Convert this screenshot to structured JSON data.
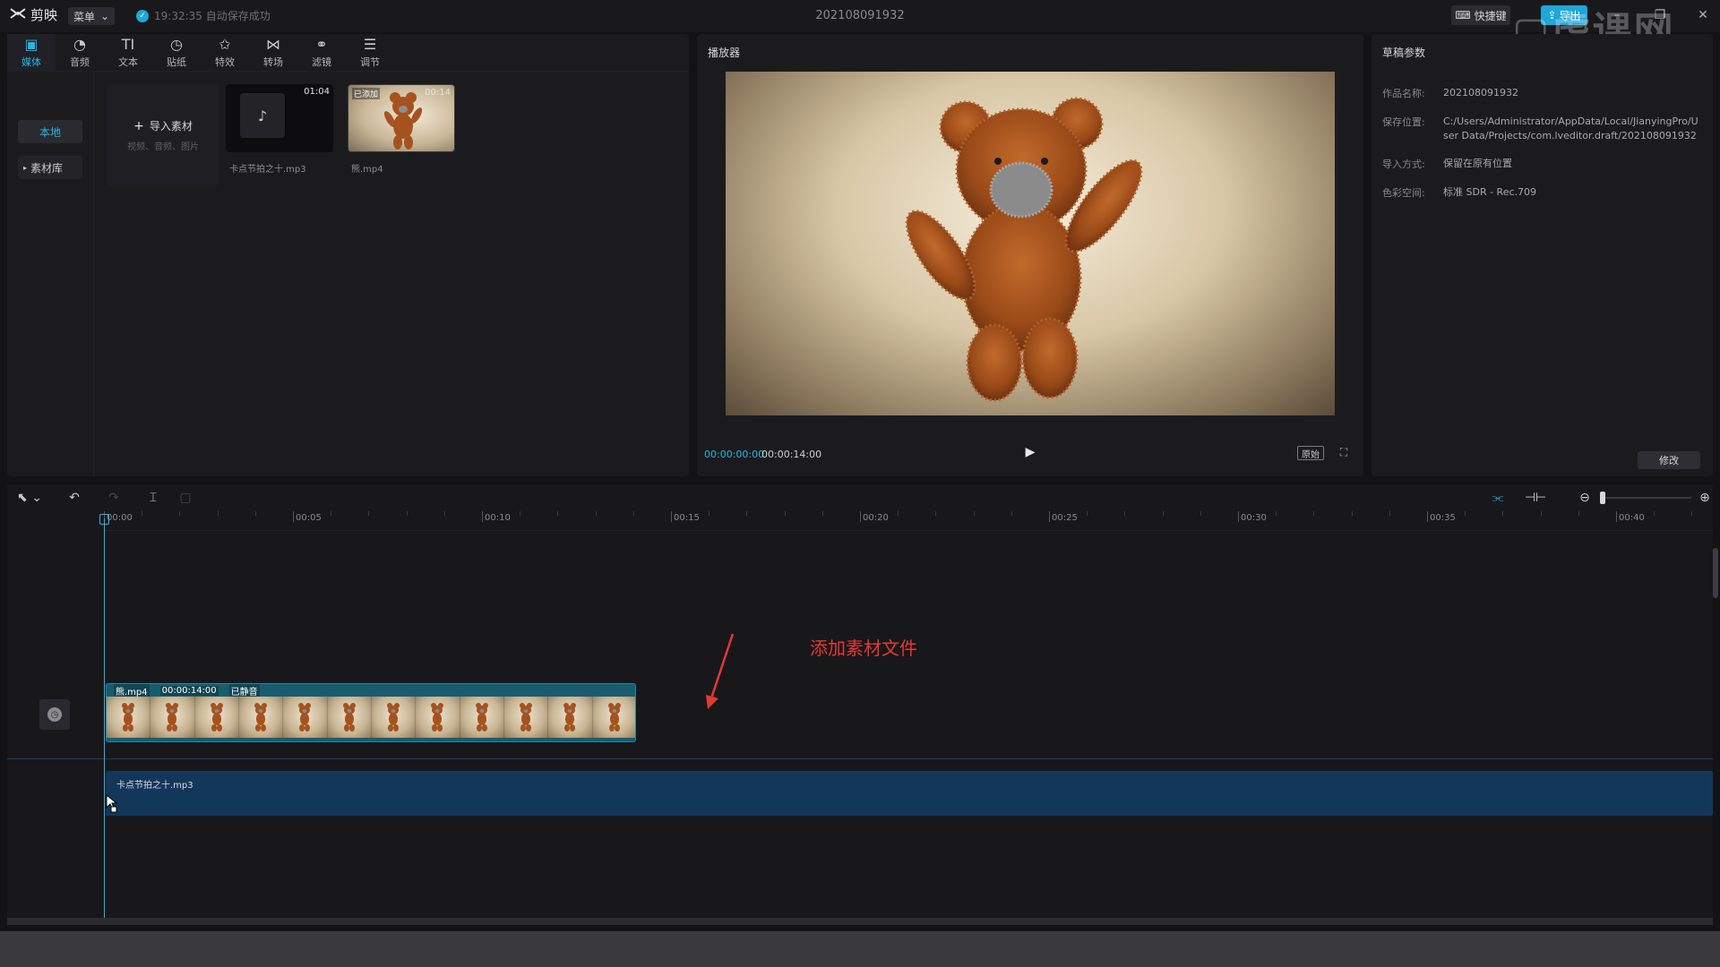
{
  "app": {
    "name": "剪映",
    "menu_label": "菜单",
    "save_status": "19:32:35 自动保存成功",
    "project_title": "202108091932",
    "shortcut_label": "快捷键",
    "export_label": "导出",
    "watermark": "虎课网"
  },
  "media_tabs": [
    {
      "label": "媒体",
      "icon": "media-icon",
      "active": true
    },
    {
      "label": "音频",
      "icon": "audio-icon"
    },
    {
      "label": "文本",
      "icon": "text-icon"
    },
    {
      "label": "贴纸",
      "icon": "sticker-icon"
    },
    {
      "label": "特效",
      "icon": "effects-icon"
    },
    {
      "label": "转场",
      "icon": "transition-icon"
    },
    {
      "label": "滤镜",
      "icon": "filter-icon"
    },
    {
      "label": "调节",
      "icon": "adjust-icon"
    }
  ],
  "media_side": {
    "local": "本地",
    "library": "素材库"
  },
  "import_card": {
    "title": "导入素材",
    "subtitle": "视频、音频、图片"
  },
  "media_items": [
    {
      "name": "卡点节拍之十.mp3",
      "duration": "01:04",
      "type": "audio"
    },
    {
      "name": "熊.mp4",
      "duration": "00:14",
      "badge": "已添加",
      "type": "video"
    }
  ],
  "player": {
    "title": "播放器",
    "current_time": "00:00:00:00",
    "total_time": "00:00:14:00",
    "original_label": "原始"
  },
  "draft": {
    "title": "草稿参数",
    "fields": [
      {
        "key": "作品名称:",
        "value": "202108091932"
      },
      {
        "key": "保存位置:",
        "value": "C:/Users/Administrator/AppData/Local/JianyingPro/User Data/Projects/com.lveditor.draft/202108091932"
      },
      {
        "key": "导入方式:",
        "value": "保留在原有位置"
      },
      {
        "key": "色彩空间:",
        "value": "标准 SDR - Rec.709"
      }
    ],
    "modify_label": "修改"
  },
  "timeline": {
    "ruler_labels": [
      "00:00",
      "00:05",
      "00:10",
      "00:15",
      "00:20",
      "00:25",
      "00:30",
      "00:35",
      "00:40"
    ],
    "video_clip": {
      "name": "熊.mp4",
      "duration": "00:00:14:00",
      "status": "已静音"
    },
    "audio_clip": {
      "name": "卡点节拍之十.mp3"
    }
  },
  "annotation": "添加素材文件",
  "colors": {
    "accent": "#27b6e6",
    "annotation": "#e53935",
    "video_clip": "#1a5c6e",
    "audio_clip": "#13375a"
  }
}
